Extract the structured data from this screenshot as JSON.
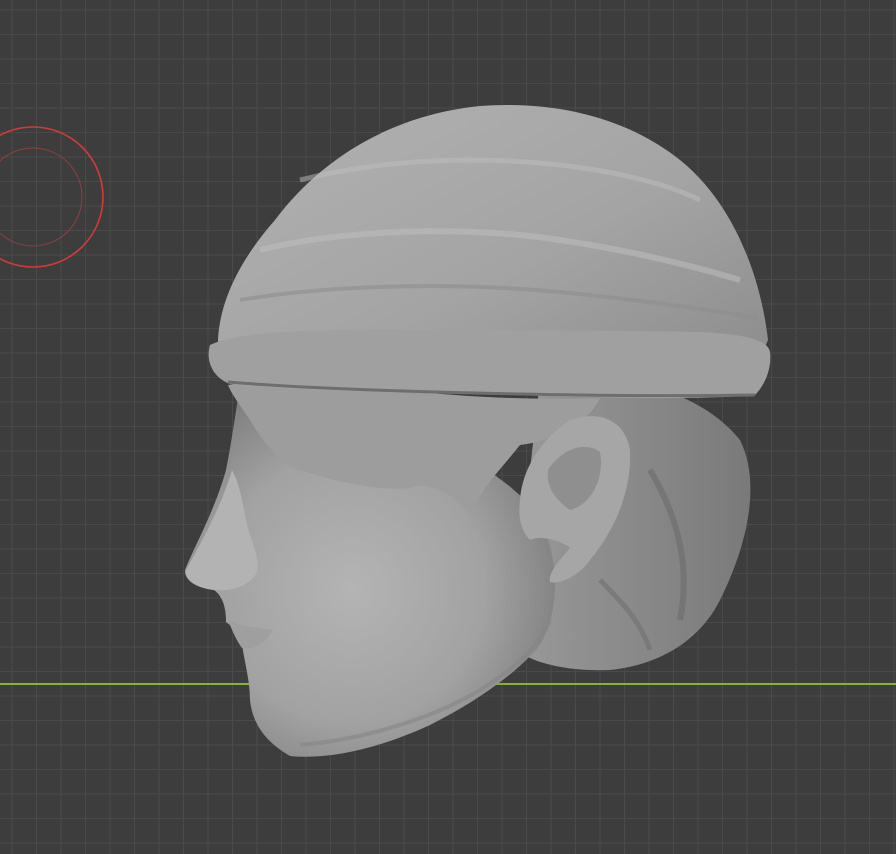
{
  "viewport": {
    "background_color": "#3d3d3d",
    "grid_color": "#4a4a4a",
    "grid_major_color": "#505050",
    "x_axis_color": "#84b33a",
    "object_color": "#a9a9a9",
    "brush_cursor_color": "#d23a3a",
    "icons": [
      "sculpt-brush-cursor-icon"
    ]
  },
  "scene": {
    "object_type": "sculpted head mesh",
    "mode": "sculpt"
  }
}
